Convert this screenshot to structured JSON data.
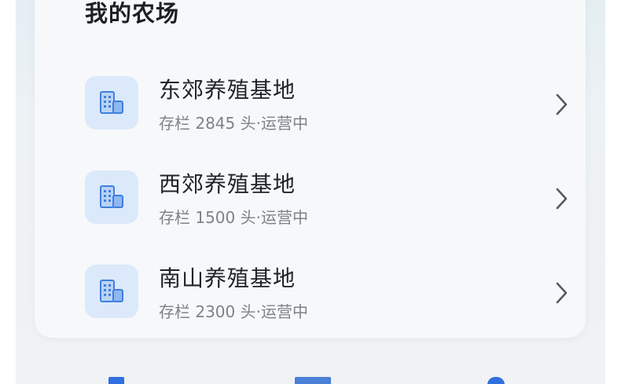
{
  "card": {
    "title": "我的农场"
  },
  "farms": [
    {
      "name": "东郊养殖基地",
      "stock_label": "存栏",
      "count": "2845",
      "unit": "头",
      "separator": "·",
      "status": "运营中",
      "icon": "building-icon"
    },
    {
      "name": "西郊养殖基地",
      "stock_label": "存栏",
      "count": "1500",
      "unit": "头",
      "separator": "·",
      "status": "运营中",
      "icon": "building-icon"
    },
    {
      "name": "南山养殖基地",
      "stock_label": "存栏",
      "count": "2300",
      "unit": "头",
      "separator": "·",
      "status": "运营中",
      "icon": "building-icon"
    }
  ],
  "colors": {
    "accent": "#2f6fe0",
    "icon_bg": "#dbe9fb",
    "title": "#1d1f24",
    "secondary_text": "#7d828a"
  }
}
